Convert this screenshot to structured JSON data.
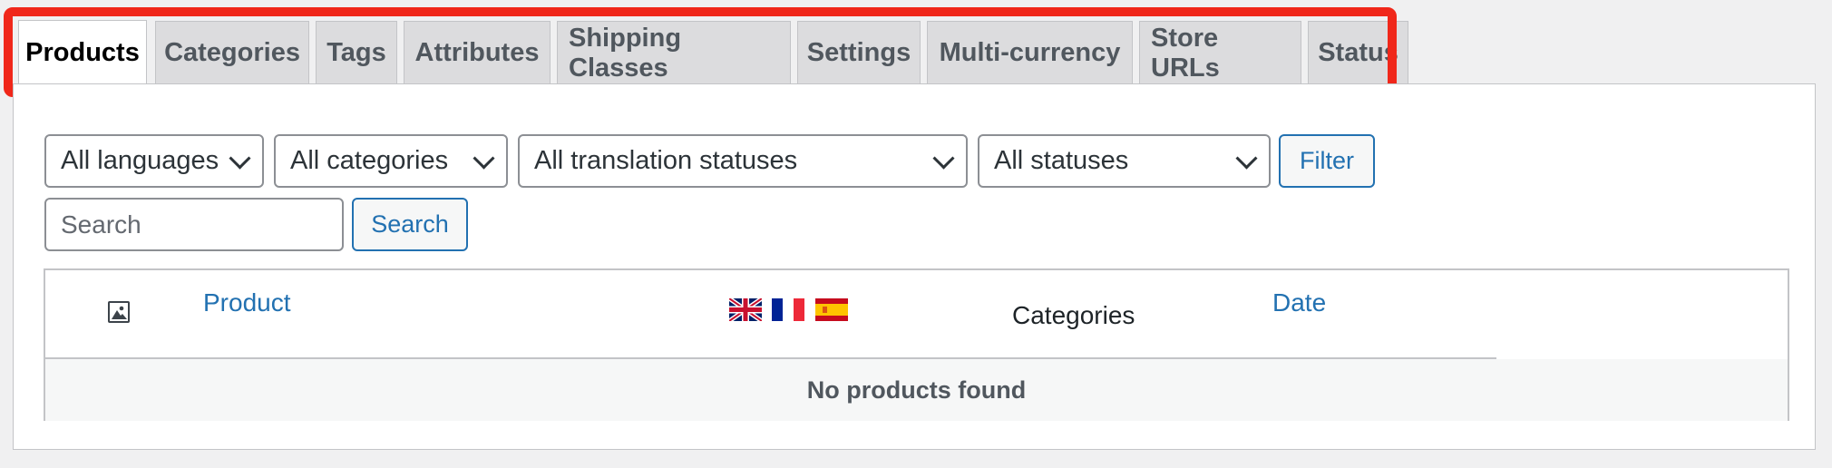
{
  "tabs": [
    {
      "label": "Products",
      "active": true
    },
    {
      "label": "Categories"
    },
    {
      "label": "Tags"
    },
    {
      "label": "Attributes"
    },
    {
      "label": "Shipping Classes"
    },
    {
      "label": "Settings"
    },
    {
      "label": "Multi-currency"
    },
    {
      "label": "Store URLs"
    },
    {
      "label": "Status"
    }
  ],
  "filters": {
    "language": "All languages",
    "category": "All categories",
    "translation_status": "All translation statuses",
    "status": "All statuses",
    "filter_button": "Filter"
  },
  "search": {
    "placeholder": "Search",
    "value": "",
    "button": "Search"
  },
  "table": {
    "columns": {
      "thumbnail_icon": "image-icon",
      "product": "Product",
      "languages": [
        "en",
        "fr",
        "es"
      ],
      "categories": "Categories",
      "date": "Date"
    },
    "empty_message": "No products found"
  },
  "colors": {
    "highlight": "#f0271a",
    "link": "#2271b1",
    "tab_bg": "#dcdcde"
  }
}
